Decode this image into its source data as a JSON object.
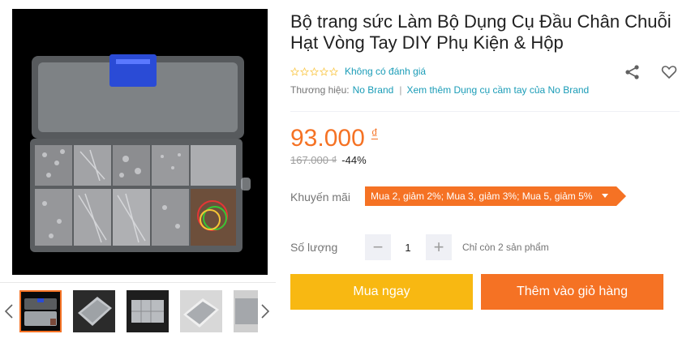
{
  "product": {
    "title": "Bộ trang sức Làm Bộ Dụng Cụ Đầu Chân Chuỗi Hạt Vòng Tay DIY Phụ Kiện & Hộp",
    "rating_text": "Không có đánh giá",
    "brand_label": "Thương hiệu:",
    "brand_name": "No Brand",
    "brand_more": "Xem thêm Dụng cụ cầm tay của No Brand"
  },
  "price": {
    "current": "93.000",
    "currency": "₫",
    "original": "167.000 ₫",
    "discount": "-44%"
  },
  "promotion": {
    "label": "Khuyến mãi",
    "tag": "Mua 2, giảm 2%; Mua 3, giảm 3%; Mua 5, giảm 5%"
  },
  "quantity": {
    "label": "Số lượng",
    "value": "1",
    "minus": "−",
    "plus": "+",
    "stock_note": "Chỉ còn 2 sản phẩm"
  },
  "actions": {
    "buy_now": "Mua ngay",
    "add_to_cart": "Thêm vào giỏ hàng"
  },
  "icons": {
    "share": "share-icon",
    "wishlist": "heart-icon",
    "prev": "chevron-left-icon",
    "next": "chevron-right-icon",
    "star": "star-outline-icon"
  },
  "colors": {
    "accent_orange": "#f57224",
    "buy_yellow": "#f8b812",
    "link_blue": "#1a9cb7"
  }
}
